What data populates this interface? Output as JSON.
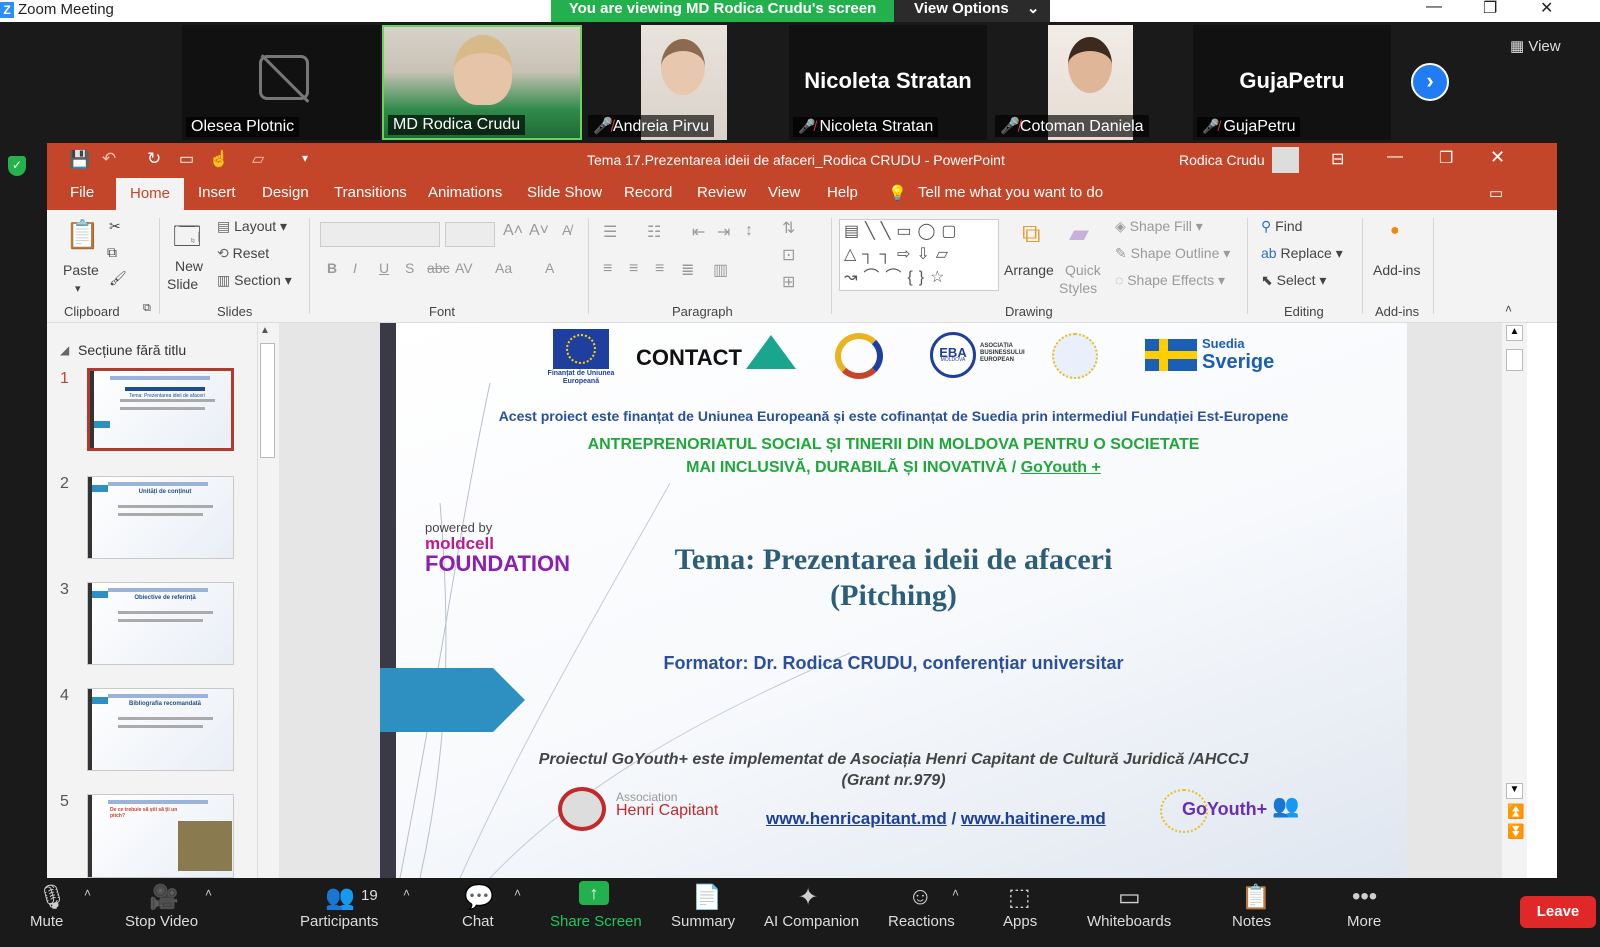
{
  "window": {
    "title": "Zoom Meeting"
  },
  "banner": {
    "text": "You are viewing MD Rodica Crudu's screen",
    "view_options": "View Options"
  },
  "gallery_view": "View",
  "participants_strip": [
    {
      "name": "Olesea Plotnic",
      "video": "off"
    },
    {
      "name": "MD Rodica Crudu",
      "video": "on",
      "active": true
    },
    {
      "name": "Andreia Pirvu",
      "video": "on",
      "muted": true
    },
    {
      "name": "Nicoleta Stratan",
      "big_name": "Nicoleta Stratan",
      "muted": true
    },
    {
      "name": "Cotoman Daniela",
      "video": "on",
      "muted": true
    },
    {
      "name": "GujaPetru",
      "big_name": "GujaPetru",
      "muted": true
    }
  ],
  "ppt": {
    "title": "Tema 17.Prezentarea ideii de afaceri_Rodica CRUDU  -  PowerPoint",
    "user": "Rodica Crudu",
    "tabs": [
      "File",
      "Home",
      "Insert",
      "Design",
      "Transitions",
      "Animations",
      "Slide Show",
      "Record",
      "Review",
      "View",
      "Help"
    ],
    "tell_me": "Tell me what you want to do",
    "ribbon": {
      "clipboard": {
        "paste": "Paste",
        "label": "Clipboard"
      },
      "slides": {
        "new_slide_1": "New",
        "new_slide_2": "Slide",
        "layout": "Layout",
        "reset": "Reset",
        "section": "Section",
        "label": "Slides"
      },
      "font": {
        "label": "Font"
      },
      "paragraph": {
        "label": "Paragraph"
      },
      "drawing": {
        "arrange": "Arrange",
        "quick_styles_1": "Quick",
        "quick_styles_2": "Styles",
        "shape_fill": "Shape Fill",
        "shape_outline": "Shape Outline",
        "shape_effects": "Shape Effects",
        "label": "Drawing"
      },
      "editing": {
        "find": "Find",
        "replace": "Replace",
        "select": "Select",
        "label": "Editing"
      },
      "addins": {
        "button": "Add-ins",
        "label": "Add-ins"
      }
    },
    "panel": {
      "section": "Secțiune fără titlu",
      "slide_numbers": [
        "1",
        "2",
        "3",
        "4",
        "5"
      ]
    },
    "thumb_titles": [
      "Tema: Prezentarea ideii de afaceri",
      "Unități de conținut",
      "Obiective de referință",
      "Bibliografia recomandată",
      "De ce trebuie să știi să ții un pitch?"
    ]
  },
  "slide": {
    "logos": {
      "eu_caption": "Finanțat de Uniunea Europeană",
      "contact": "CONTACT",
      "eba": "EBA",
      "eba_sub": "MOLDOVA",
      "eba_assoc": "ASOCIAȚIA BUSINESSULUI EUROPEAN",
      "suedia": "Suedia",
      "sverige": "Sverige"
    },
    "funding": "Acest proiect este finanțat de Uniunea Europeană și este cofinanțat de Suedia prin intermediul Fundației Est-Europene",
    "project_line1": "ANTREPRENORIATUL SOCIAL ȘI TINERII DIN MOLDOVA  PENTRU O SOCIETATE",
    "project_line2_a": "MAI INCLUSIVĂ, DURABILĂ ȘI INOVATIVĂ  / ",
    "project_line2_b": "GoYouth +",
    "powered_by": "powered by",
    "moldcell": "moldcell",
    "foundation": "FOUNDATION",
    "theme_line1": "Tema: Prezentarea ideii de afaceri",
    "theme_line2": "(Pitching)",
    "trainer": "Formator: Dr. Rodica CRUDU, conferențiar universitar",
    "impl_line1": "Proiectul GoYouth+ este implementat de  Asociația Henri Capitant de Cultură Juridică /AHCCJ",
    "impl_line2": "(Grant nr.979)",
    "assoc_small": "Association",
    "assoc_name": "Henri Capitant",
    "link1": "www.henricapitant.md",
    "link_sep": " / ",
    "link2": "www.haitinere.md",
    "goyouth_logo": "GoYouth+"
  },
  "toolbar": {
    "mute": "Mute",
    "stop_video": "Stop Video",
    "participants": "Participants",
    "participants_count": "19",
    "chat": "Chat",
    "share_screen": "Share Screen",
    "summary": "Summary",
    "ai_companion": "AI Companion",
    "reactions": "Reactions",
    "apps": "Apps",
    "whiteboards": "Whiteboards",
    "notes": "Notes",
    "more": "More",
    "leave": "Leave"
  },
  "colors": {
    "ppt_accent": "#c4462a",
    "zoom_green": "#22b14c",
    "leave_red": "#e02828",
    "slide_green": "#1fa83a",
    "slide_blue": "#2b4f9a",
    "theme_color": "#2c5e7a"
  }
}
